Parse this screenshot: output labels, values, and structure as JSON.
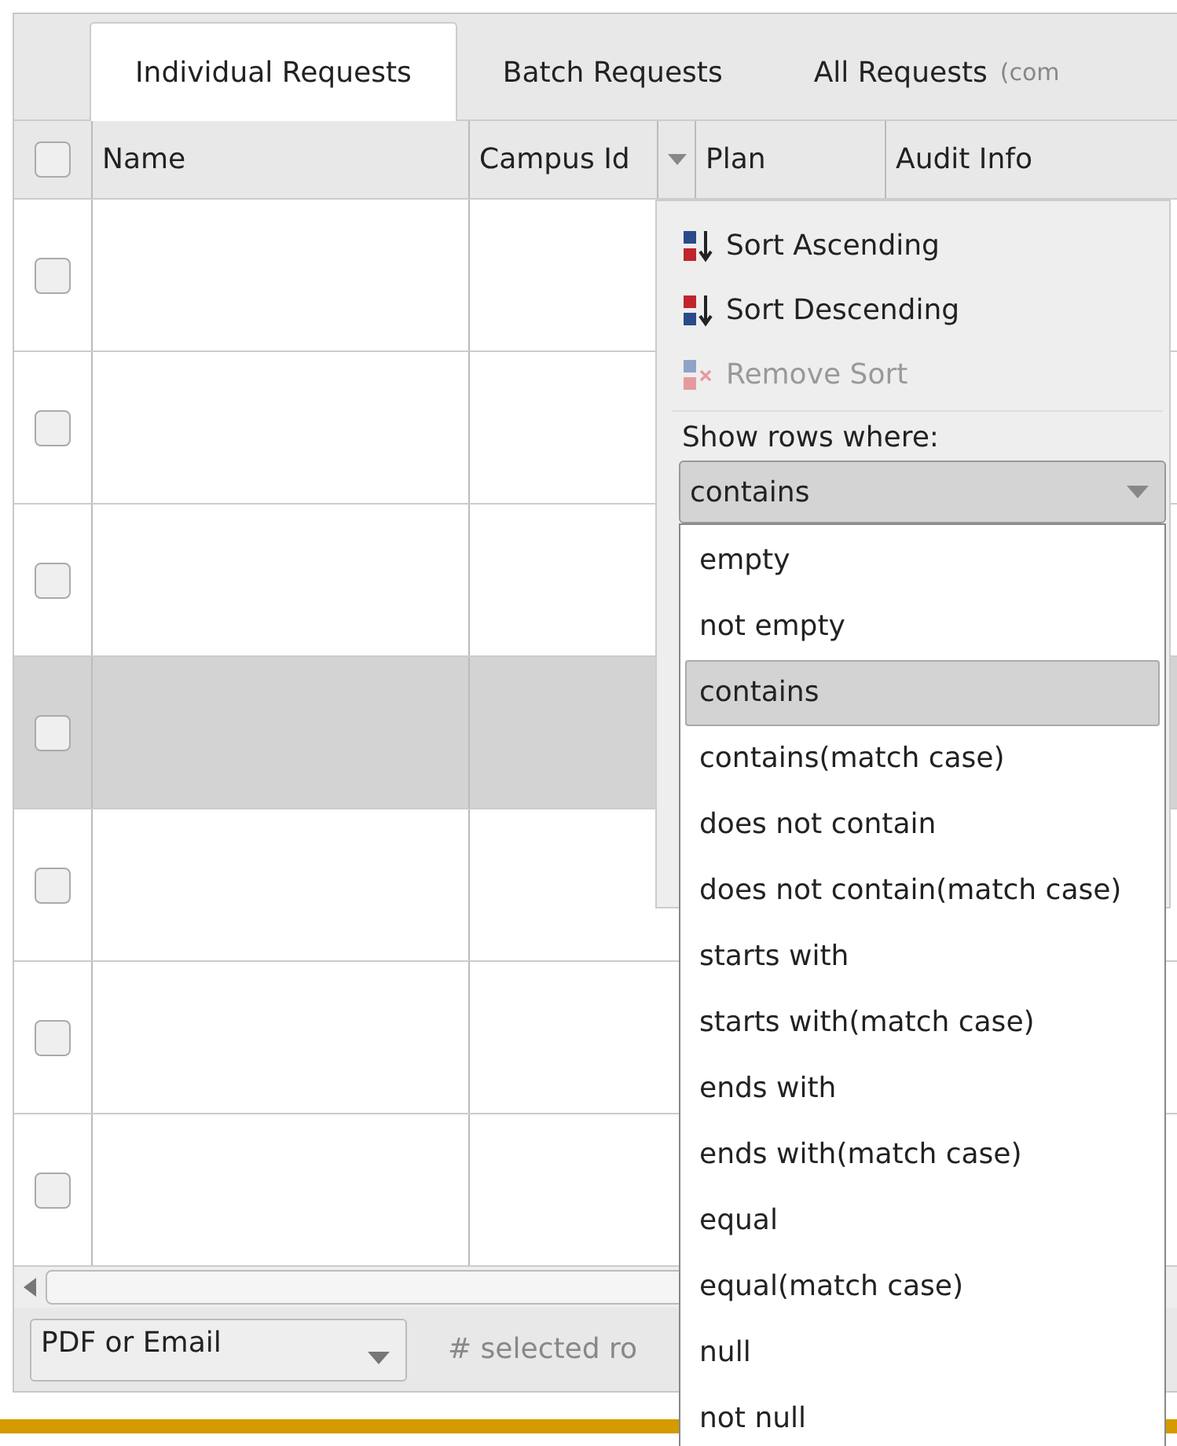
{
  "tabs": [
    {
      "label": "Individual Requests",
      "selected": true
    },
    {
      "label": "Batch Requests",
      "selected": false
    },
    {
      "label": "All Requests",
      "note": "(com",
      "selected": false
    }
  ],
  "table": {
    "select_all_checked": false,
    "columns": [
      "Name",
      "Campus Id",
      "Plan",
      "Audit Info"
    ],
    "rows": [
      {
        "selected": false,
        "checked": false
      },
      {
        "selected": false,
        "checked": false
      },
      {
        "selected": false,
        "checked": false
      },
      {
        "selected": true,
        "checked": false
      },
      {
        "selected": false,
        "checked": false
      },
      {
        "selected": false,
        "checked": false
      },
      {
        "selected": false,
        "checked": false
      }
    ]
  },
  "column_menu": {
    "items": [
      {
        "kind": "ascending",
        "label": "Sort Ascending",
        "disabled": false
      },
      {
        "kind": "descending",
        "label": "Sort Descending",
        "disabled": false
      },
      {
        "kind": "remove",
        "label": "Remove Sort",
        "disabled": true
      }
    ],
    "filter_label": "Show rows where:",
    "filter_value": "contains",
    "options": [
      {
        "label": "empty",
        "selected": false
      },
      {
        "label": "not empty",
        "selected": false
      },
      {
        "label": "contains",
        "selected": true
      },
      {
        "label": "contains(match case)",
        "selected": false
      },
      {
        "label": "does not contain",
        "selected": false
      },
      {
        "label": "does not contain(match case)",
        "selected": false
      },
      {
        "label": "starts with",
        "selected": false
      },
      {
        "label": "starts with(match case)",
        "selected": false
      },
      {
        "label": "ends with",
        "selected": false
      },
      {
        "label": "ends with(match case)",
        "selected": false
      },
      {
        "label": "equal",
        "selected": false
      },
      {
        "label": "equal(match case)",
        "selected": false
      },
      {
        "label": "null",
        "selected": false
      },
      {
        "label": "not null",
        "selected": false
      }
    ]
  },
  "footer": {
    "export_select": "PDF or Email",
    "selected_rows_placeholder": "# selected ro"
  }
}
